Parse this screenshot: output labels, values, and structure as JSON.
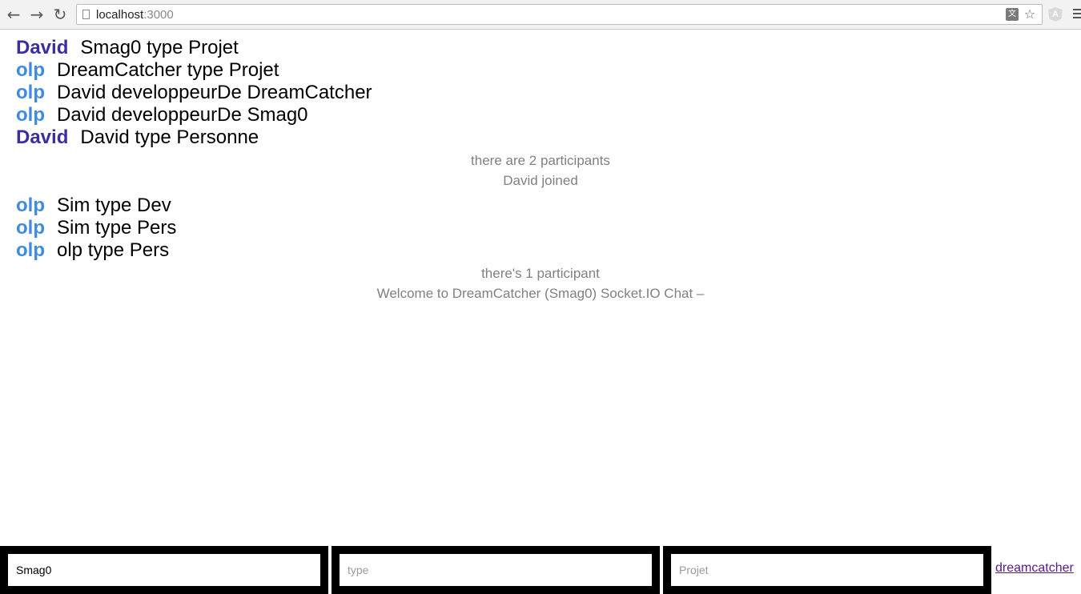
{
  "browser": {
    "url_host": "localhost",
    "url_port": ":3000",
    "back_icon": "←",
    "forward_icon": "→",
    "reload_icon": "↻",
    "translate_icon": "文",
    "star_icon": "☆",
    "extension_icon": "A"
  },
  "messages": [
    {
      "user": "David",
      "text": "Smag0 type Projet"
    },
    {
      "user": "olp",
      "text": "DreamCatcher type Projet"
    },
    {
      "user": "olp",
      "text": "David developpeurDe DreamCatcher"
    },
    {
      "user": "olp",
      "text": "David developpeurDe Smag0"
    },
    {
      "user": "David",
      "text": "David type Personne"
    }
  ],
  "logs_1": [
    "there are 2 participants",
    "David joined"
  ],
  "messages_2": [
    {
      "user": "olp",
      "text": "Sim type Dev"
    },
    {
      "user": "olp",
      "text": "Sim type Pers"
    },
    {
      "user": "olp",
      "text": "olp type Pers"
    }
  ],
  "logs_2": [
    "there's 1 participant",
    "Welcome to DreamCatcher (Smag0) Socket.IO Chat –"
  ],
  "form": {
    "subject_value": "Smag0",
    "predicate_placeholder": "type",
    "object_placeholder": "Projet",
    "link_label": "dreamcatcher"
  },
  "colors": {
    "david": "#3b2ea2",
    "olp": "#3f8be0",
    "log_text": "#808080",
    "input_frame": "#000000"
  }
}
